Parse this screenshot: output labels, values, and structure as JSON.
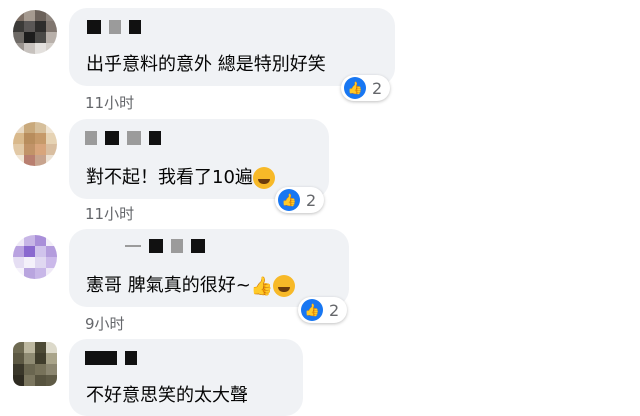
{
  "comments": [
    {
      "text": "出乎意料的意外 總是特別好笑",
      "time": "11小时",
      "likes": "2"
    },
    {
      "text": "對不起！我看了10遍",
      "time": "11小时",
      "likes": "2"
    },
    {
      "text": "憲哥 脾氣真的很好~",
      "time": "9小时",
      "likes": "2"
    },
    {
      "text": "不好意思笑的太大聲",
      "time": "",
      "likes": ""
    }
  ],
  "icons": {
    "like": "thumbs-up-icon",
    "laugh": "rolling-laughing-emoji",
    "thumb": "thumbs-up-emoji"
  },
  "colors": {
    "bubble": "#f0f2f5",
    "like": "#1877f2",
    "meta": "#65676b"
  }
}
